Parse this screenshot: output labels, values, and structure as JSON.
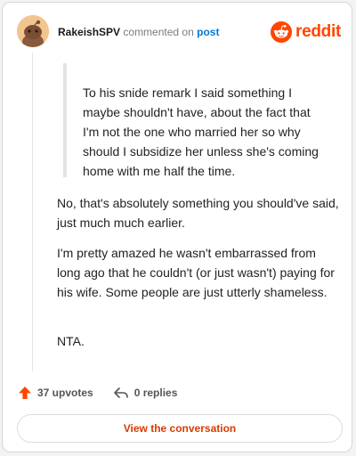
{
  "comment": {
    "username": "RakeishSPV",
    "action_text": "commented on",
    "post_link": "post",
    "quote": "To his snide remark I said something I maybe shouldn't have, about the fact that I'm not the one who married her so why should I subsidize her unless she's coming home with me half the time.",
    "paragraphs": [
      "No, that's absolutely something you should've said, just much much earlier.",
      "I'm pretty amazed he wasn't embarrassed from long ago that he couldn't (or just wasn't) paying for his wife. Some people are just utterly shameless.",
      "NTA."
    ]
  },
  "brand": {
    "wordmark": "reddit",
    "color": "#ff4500"
  },
  "actions": {
    "upvotes_label": "37 upvotes",
    "replies_label": "0 replies"
  },
  "footer": {
    "conversation_button": "View the conversation"
  },
  "icons": {
    "upvote": "upvote-arrow-icon",
    "reply": "reply-arrow-icon",
    "avatar": "snoo-avatar",
    "logo": "reddit-snoo-logo-icon"
  }
}
